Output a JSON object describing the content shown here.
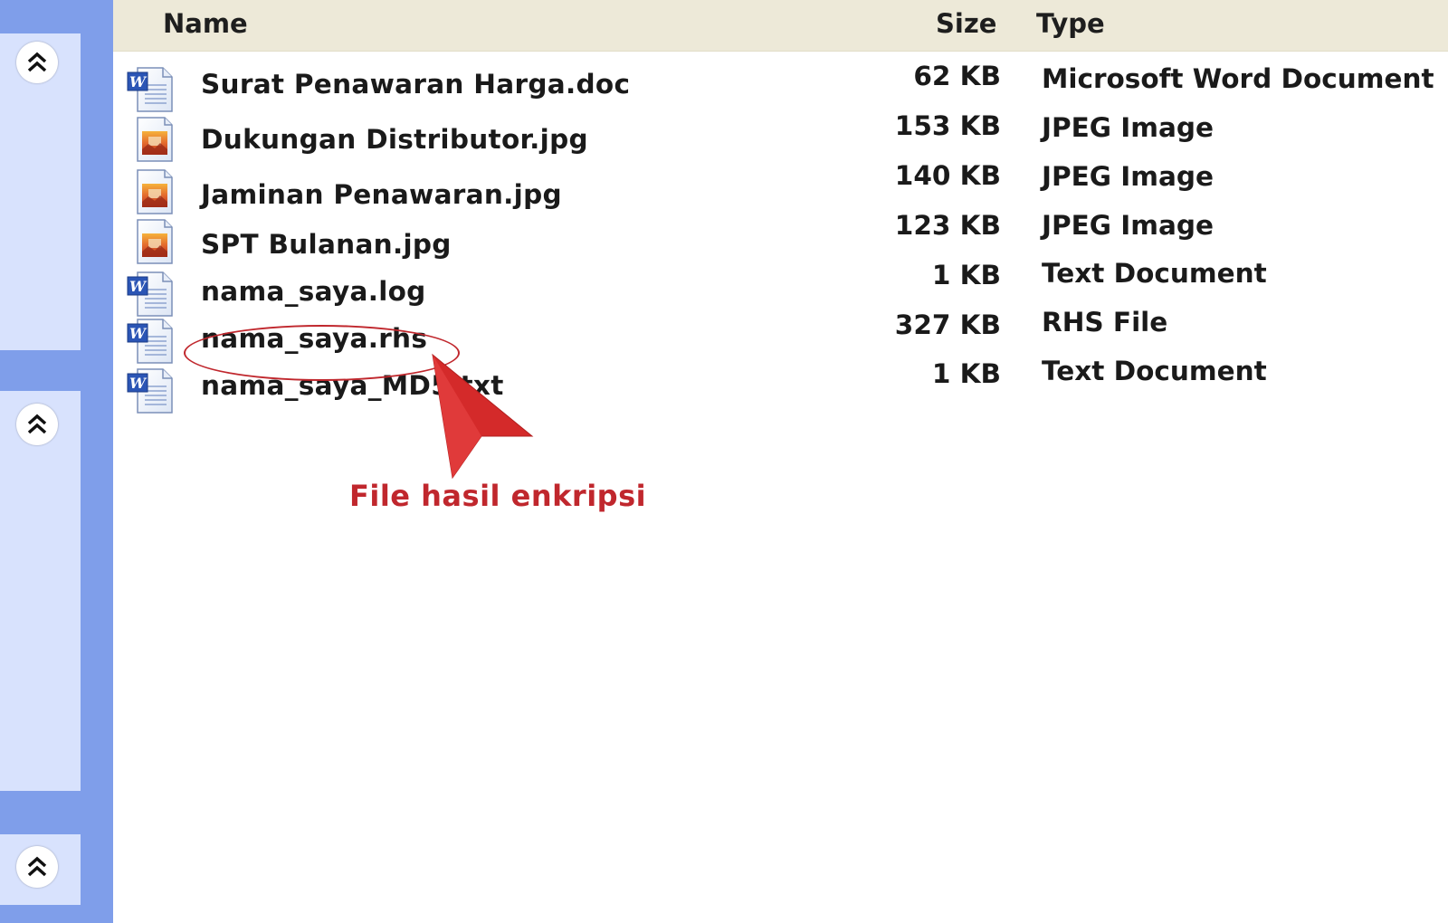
{
  "columns": {
    "name": "Name",
    "size": "Size",
    "type": "Type"
  },
  "files": [
    {
      "name": "Surat Penawaran Harga.doc",
      "size": "62 KB",
      "type": "Microsoft Word Document",
      "icon": "word-doc-icon"
    },
    {
      "name": "Dukungan Distributor.jpg",
      "size": "153 KB",
      "type": "JPEG Image",
      "icon": "jpeg-image-icon"
    },
    {
      "name": "Jaminan Penawaran.jpg",
      "size": "140 KB",
      "type": "JPEG Image",
      "icon": "jpeg-image-icon"
    },
    {
      "name": "SPT Bulanan.jpg",
      "size": "123 KB",
      "type": "JPEG Image",
      "icon": "jpeg-image-icon"
    },
    {
      "name": "nama_saya.log",
      "size": "1 KB",
      "type": "Text Document",
      "icon": "word-doc-icon"
    },
    {
      "name": "nama_saya.rhs",
      "size": "327 KB",
      "type": "RHS File",
      "icon": "word-doc-icon"
    },
    {
      "name": "nama_saya_MD5.txt",
      "size": "1 KB",
      "type": "Text Document",
      "icon": "word-doc-icon"
    }
  ],
  "annotation": {
    "label": "File hasil enkripsi",
    "color": "#c0272d"
  },
  "sidebar": {
    "chevrons": [
      "collapse-up-icon",
      "collapse-up-icon",
      "collapse-up-icon"
    ]
  }
}
